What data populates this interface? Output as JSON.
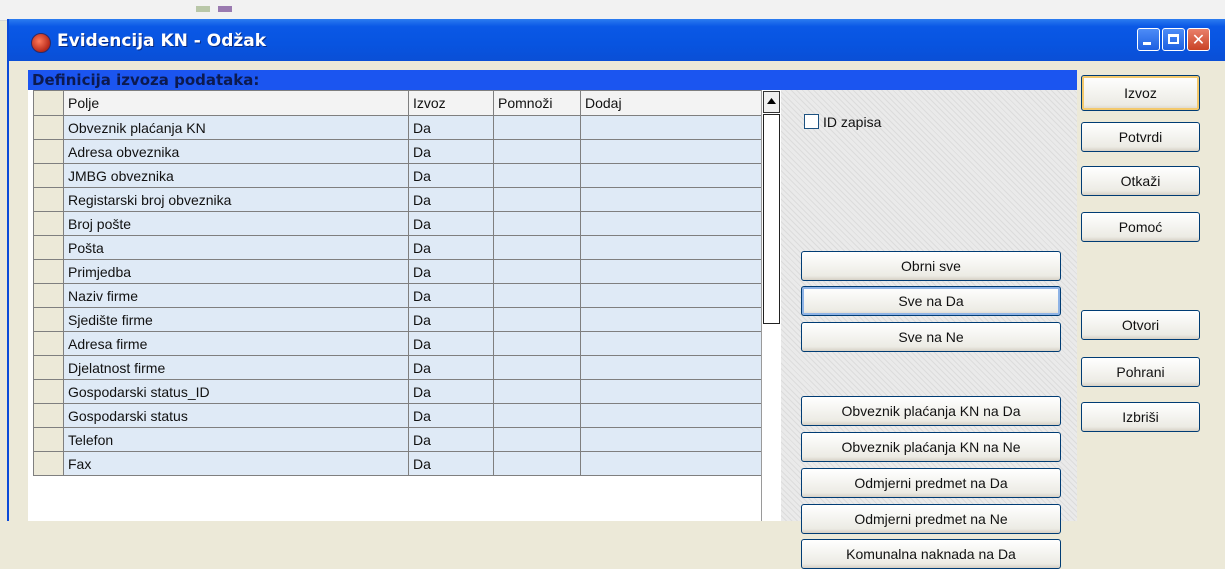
{
  "window": {
    "title": "Evidencija KN - Odžak"
  },
  "panel": {
    "title": "Definicija izvoza podataka:"
  },
  "table": {
    "columns": [
      "Polje",
      "Izvoz",
      "Pomnoži",
      "Dodaj"
    ],
    "rows": [
      {
        "polje": "Obveznik plaćanja KN",
        "izvoz": "Da",
        "pomnozi": "",
        "dodaj": ""
      },
      {
        "polje": "Adresa obveznika",
        "izvoz": "Da",
        "pomnozi": "",
        "dodaj": ""
      },
      {
        "polje": "JMBG obveznika",
        "izvoz": "Da",
        "pomnozi": "",
        "dodaj": ""
      },
      {
        "polje": "Registarski broj obveznika",
        "izvoz": "Da",
        "pomnozi": "",
        "dodaj": ""
      },
      {
        "polje": "Broj pošte",
        "izvoz": "Da",
        "pomnozi": "",
        "dodaj": ""
      },
      {
        "polje": "Pošta",
        "izvoz": "Da",
        "pomnozi": "",
        "dodaj": ""
      },
      {
        "polje": "Primjedba",
        "izvoz": "Da",
        "pomnozi": "",
        "dodaj": ""
      },
      {
        "polje": "Naziv firme",
        "izvoz": "Da",
        "pomnozi": "",
        "dodaj": ""
      },
      {
        "polje": "Sjedište firme",
        "izvoz": "Da",
        "pomnozi": "",
        "dodaj": ""
      },
      {
        "polje": "Adresa firme",
        "izvoz": "Da",
        "pomnozi": "",
        "dodaj": ""
      },
      {
        "polje": "Djelatnost firme",
        "izvoz": "Da",
        "pomnozi": "",
        "dodaj": ""
      },
      {
        "polje": "Gospodarski status_ID",
        "izvoz": "Da",
        "pomnozi": "",
        "dodaj": ""
      },
      {
        "polje": "Gospodarski status",
        "izvoz": "Da",
        "pomnozi": "",
        "dodaj": ""
      },
      {
        "polje": "Telefon",
        "izvoz": "Da",
        "pomnozi": "",
        "dodaj": ""
      },
      {
        "polje": "Fax",
        "izvoz": "Da",
        "pomnozi": "",
        "dodaj": ""
      }
    ]
  },
  "id_zapisa": {
    "label": "ID zapisa",
    "checked": false
  },
  "action_buttons": [
    "Obrni sve",
    "Sve na Da",
    "Sve na Ne",
    "Obveznik plaćanja KN na Da",
    "Obveznik plaćanja KN na Ne",
    "Odmjerni predmet na Da",
    "Odmjerni predmet na Ne",
    "Komunalna naknada na Da"
  ],
  "side_buttons": {
    "izvoz": "Izvoz",
    "potvrdi": "Potvrdi",
    "otkazi": "Otkaži",
    "pomoc": "Pomoć",
    "otvori": "Otvori",
    "pohrani": "Pohrani",
    "izbrisi": "Izbriši"
  },
  "colors": {
    "titlebar": "#0854e0",
    "panel_title": "#1b55f0",
    "row_bg": "#dfeaf6",
    "dialog_bg": "#ece9d8"
  }
}
